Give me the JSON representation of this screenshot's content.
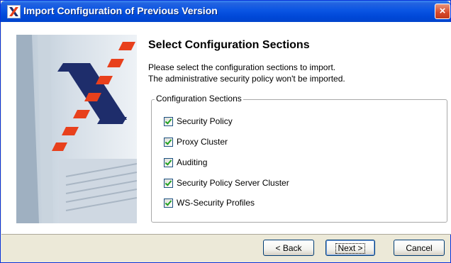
{
  "window": {
    "title": "Import Configuration of Previous Version",
    "close_glyph": "×"
  },
  "page": {
    "heading": "Select Configuration Sections",
    "description_line1": "Please select the configuration sections to import.",
    "description_line2": "The administrative security policy won't be imported."
  },
  "sections": {
    "legend": "Configuration Sections",
    "items": [
      {
        "label": "Security Policy",
        "checked": true
      },
      {
        "label": "Proxy Cluster",
        "checked": true
      },
      {
        "label": "Auditing",
        "checked": true
      },
      {
        "label": "Security Policy Server Cluster",
        "checked": true
      },
      {
        "label": "WS-Security Profiles",
        "checked": true
      }
    ]
  },
  "buttons": {
    "back": "< Back",
    "next": "Next >",
    "cancel": "Cancel"
  },
  "colors": {
    "titlebar": "#0a55e3",
    "logo_red": "#e8401c",
    "logo_navy": "#1e2d6b"
  }
}
